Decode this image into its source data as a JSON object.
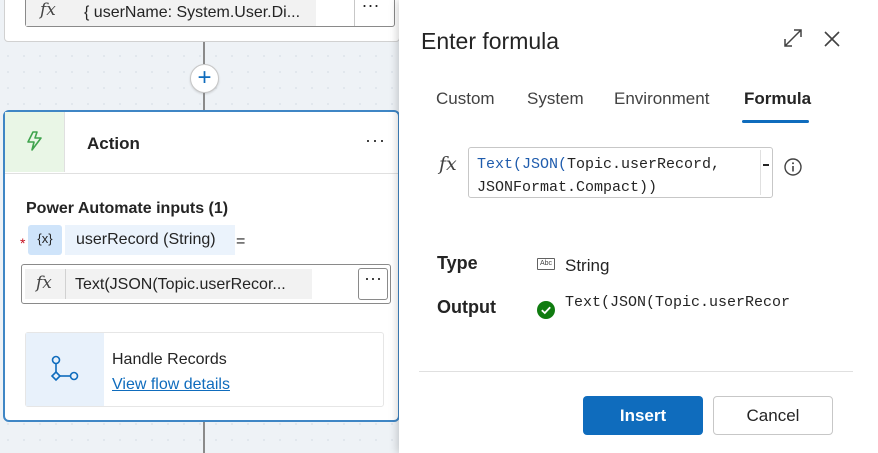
{
  "canvas": {
    "top_card": {
      "formula": "{ userName: System.User.Di..."
    },
    "action": {
      "title": "Action",
      "more": "···",
      "inputs_label": "Power Automate inputs (1)",
      "required_mark": "*",
      "var_chip": "{x}",
      "var_label": "userRecord (String)",
      "equals": "=",
      "input_formula": "Text(JSON(Topic.userRecor...",
      "fx": "fx",
      "flow": {
        "title": "Handle Records",
        "link": "View flow details"
      }
    },
    "add": "+"
  },
  "dialog": {
    "title": "Enter formula",
    "tabs": [
      {
        "label": "Custom"
      },
      {
        "label": "System"
      },
      {
        "label": "Environment"
      },
      {
        "label": "Formula"
      }
    ],
    "active_tab": "Formula",
    "fx": "fx",
    "formula": {
      "line1_fn": "Text(JSON(",
      "line1_rest": "Topic.userRecord,",
      "line2": "JSONFormat.Compact))"
    },
    "type_label": "Type",
    "type_icon": "Abc",
    "type_value": "String",
    "output_label": "Output",
    "output_value": "Text(JSON(Topic.userRecor",
    "insert_label": "Insert",
    "cancel_label": "Cancel"
  },
  "colors": {
    "accent": "#0f6cbd",
    "success": "#107c10",
    "required": "#c50f1f"
  },
  "icons": [
    "fx-icon",
    "plus-icon",
    "lightning-icon",
    "flow-icon",
    "expand-icon",
    "close-icon",
    "info-icon",
    "text-type-icon",
    "check-circle-icon"
  ]
}
